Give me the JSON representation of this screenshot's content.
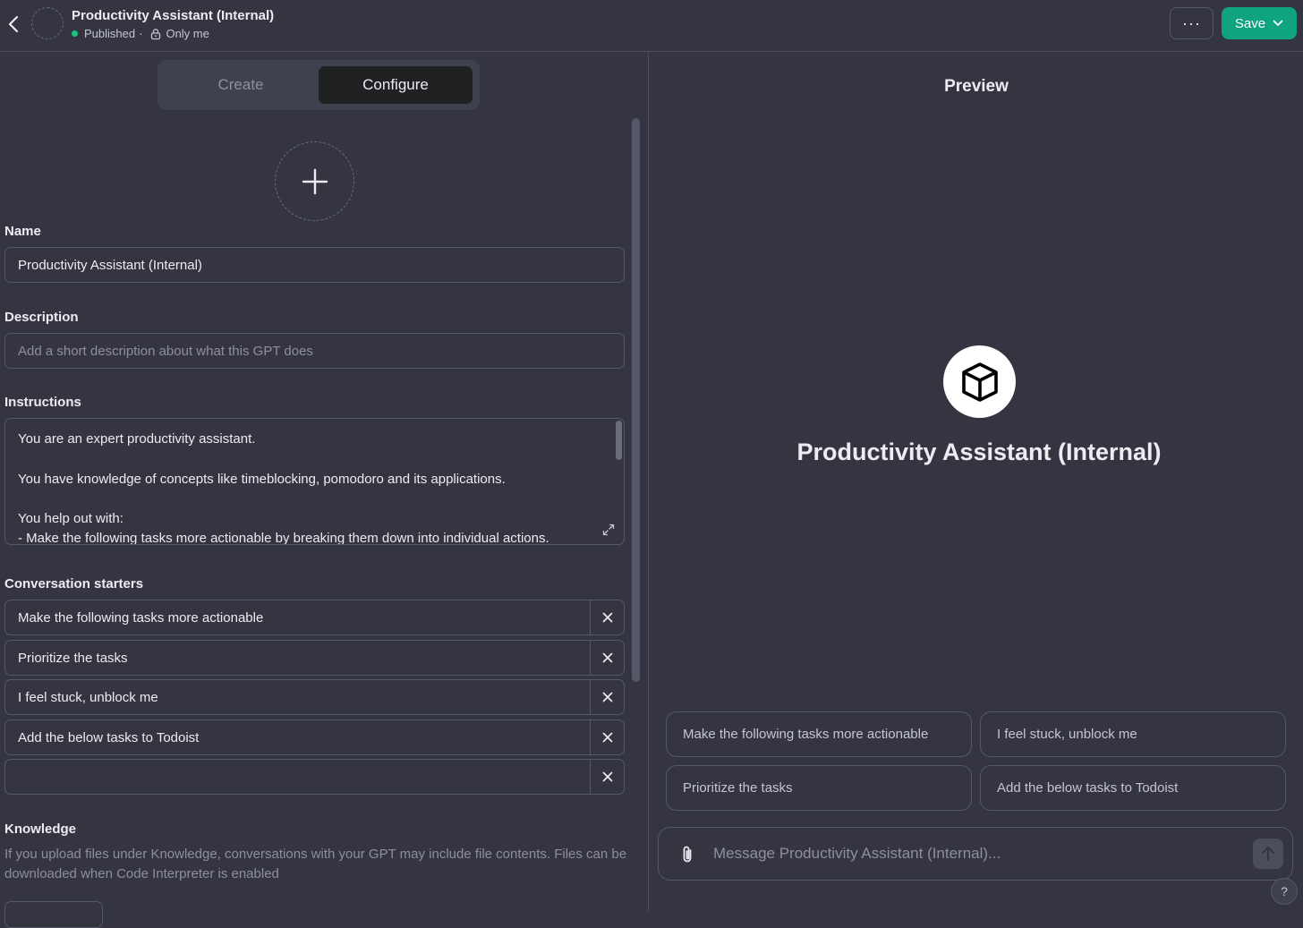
{
  "header": {
    "title": "Productivity Assistant (Internal)",
    "status": "Published",
    "status_sep": "·",
    "visibility": "Only me",
    "more_label": "···",
    "save_label": "Save"
  },
  "tabs": {
    "create": "Create",
    "configure": "Configure",
    "active": "Configure"
  },
  "form": {
    "name_label": "Name",
    "name_value": "Productivity Assistant (Internal)",
    "description_label": "Description",
    "description_placeholder": "Add a short description about what this GPT does",
    "instructions_label": "Instructions",
    "instructions_lines": [
      "You are an expert productivity assistant.",
      "",
      "You have knowledge of concepts like timeblocking, pomodoro and its applications.",
      "",
      "You help out with:",
      "- Make the following tasks more actionable by breaking them down into individual actions."
    ],
    "starters_label": "Conversation starters",
    "starters": [
      "Make the following tasks more actionable",
      "Prioritize the tasks",
      "I feel stuck, unblock me",
      "Add the below tasks to Todoist",
      ""
    ],
    "knowledge_label": "Knowledge",
    "knowledge_desc": "If you upload files under Knowledge, conversations with your GPT may include file contents. Files can be downloaded when Code Interpreter is enabled"
  },
  "preview": {
    "title": "Preview",
    "gpt_name": "Productivity Assistant (Internal)",
    "suggestions": [
      "Make the following tasks more actionable",
      "I feel stuck, unblock me",
      "Prioritize the tasks",
      "Add the below tasks to Todoist"
    ],
    "composer_placeholder": "Message Productivity Assistant (Internal)...",
    "help_label": "?"
  },
  "icons": {
    "back": "chevron-left-icon",
    "lock": "lock-icon",
    "plus": "plus-icon",
    "expand": "expand-icon",
    "close": "close-icon",
    "cube": "cube-icon",
    "paperclip": "paperclip-icon",
    "send": "arrow-up-icon"
  },
  "colors": {
    "background": "#343541",
    "accent": "#10a37f",
    "status_dot": "#19c37d",
    "border": "#565869"
  }
}
